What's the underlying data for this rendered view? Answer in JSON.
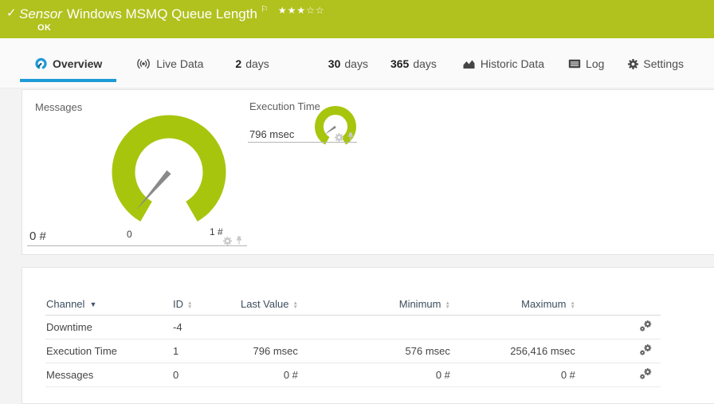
{
  "colors": {
    "header_green": "#b1c11d",
    "gauge_green": "#a8c50e",
    "accent_blue": "#1d9bd7"
  },
  "header": {
    "check": "✓",
    "kind": "Sensor",
    "title": "Windows MSMQ Queue Length",
    "flag": "⚐",
    "priority_stars": "★★★☆☆",
    "status": "OK"
  },
  "tabs": [
    {
      "label": "Overview",
      "icon": "gauge-icon",
      "active": true
    },
    {
      "label": "Live Data",
      "icon": "live-icon"
    },
    {
      "number": "2",
      "unit": "days"
    },
    {
      "number": "30",
      "unit": "days"
    },
    {
      "number": "365",
      "unit": "days"
    },
    {
      "label": "Historic Data",
      "icon": "area-chart-icon"
    },
    {
      "label": "Log",
      "icon": "log-icon"
    },
    {
      "label": "Settings",
      "icon": "gear-icon"
    }
  ],
  "gauges": {
    "messages": {
      "label": "Messages",
      "value": "0 #",
      "scale_min": "0",
      "scale_max": "1 #"
    },
    "execution_time": {
      "label": "Execution Time",
      "value": "796 msec"
    }
  },
  "chart_data": [
    {
      "type": "gauge",
      "title": "Messages",
      "value": 0,
      "unit": "#",
      "scale_min": 0,
      "scale_max": 1,
      "current_label": "0 #"
    },
    {
      "type": "gauge",
      "title": "Execution Time",
      "value": 796,
      "unit": "msec",
      "current_label": "796 msec"
    }
  ],
  "table": {
    "headers": {
      "channel": "Channel",
      "id": "ID",
      "last_value": "Last Value",
      "minimum": "Minimum",
      "maximum": "Maximum"
    },
    "rows": [
      {
        "channel": "Downtime",
        "id": "-4",
        "last_value": "",
        "minimum": "",
        "maximum": ""
      },
      {
        "channel": "Execution Time",
        "id": "1",
        "last_value": "796 msec",
        "minimum": "576 msec",
        "maximum": "256,416 msec"
      },
      {
        "channel": "Messages",
        "id": "0",
        "last_value": "0 #",
        "minimum": "0 #",
        "maximum": "0 #"
      }
    ]
  }
}
